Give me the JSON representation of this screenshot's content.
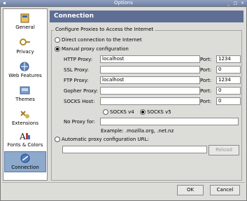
{
  "window": {
    "title": "Options"
  },
  "sidebar": {
    "items": [
      {
        "label": "General",
        "icon": "general-icon"
      },
      {
        "label": "Privacy",
        "icon": "privacy-icon"
      },
      {
        "label": "Web Features",
        "icon": "web-features-icon"
      },
      {
        "label": "Themes",
        "icon": "themes-icon"
      },
      {
        "label": "Extensions",
        "icon": "extensions-icon"
      },
      {
        "label": "Fonts & Colors",
        "icon": "fonts-colors-icon"
      },
      {
        "label": "Connection",
        "icon": "connection-icon"
      }
    ],
    "selected": "Connection"
  },
  "panel": {
    "header": "Connection",
    "group_label": "Configure Proxies to Access the Internet",
    "direct_label": "Direct connection to the Internet",
    "manual_label": "Manual proxy configuration",
    "fields": [
      {
        "label": "HTTP Proxy:",
        "value": "localhost",
        "port_label": "Port:",
        "port": "1234"
      },
      {
        "label": "SSL Proxy:",
        "value": "",
        "port_label": "Port:",
        "port": "0"
      },
      {
        "label": "FTP Proxy:",
        "value": "localhost",
        "port_label": "Port:",
        "port": "1234"
      },
      {
        "label": "Gopher Proxy:",
        "value": "",
        "port_label": "Port:",
        "port": "0"
      },
      {
        "label": "SOCKS Host:",
        "value": "",
        "port_label": "Port:",
        "port": "0"
      }
    ],
    "socks_v4": "SOCKS v4",
    "socks_v5": "SOCKS v5",
    "no_proxy_label": "No Proxy for:",
    "no_proxy_value": "",
    "example": "Example: .mozilla.org, .net.nz",
    "auto_label": "Automatic proxy configuration URL:",
    "auto_value": "",
    "reload": "Reload"
  },
  "buttons": {
    "ok": "OK",
    "cancel": "Cancel"
  },
  "colors": {
    "header": "#5f6e94",
    "selection": "#8da9cc"
  }
}
